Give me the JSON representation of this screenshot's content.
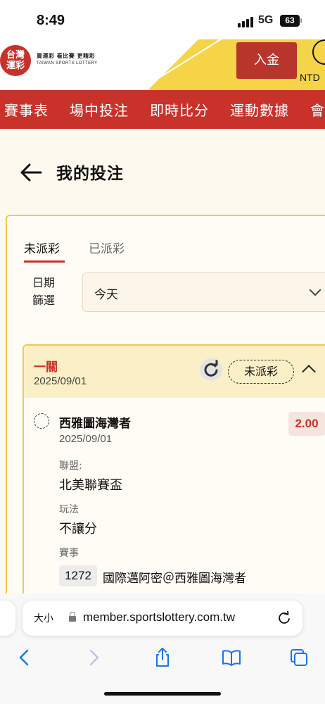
{
  "status_bar": {
    "time": "8:49",
    "network": "5G",
    "battery": "63"
  },
  "header": {
    "logo_mark": "台灣\n運彩",
    "logo_tagline": "買運彩 看比賽 更精彩",
    "logo_english": "TAIWAN SPORTS LOTTERY",
    "deposit_label": "入金",
    "currency": "NTD"
  },
  "nav": {
    "items": [
      "賽事表",
      "場中投注",
      "即時比分",
      "運動數據",
      "會員專"
    ]
  },
  "page": {
    "title": "我的投注",
    "tabs": [
      {
        "label": "未派彩",
        "active": true
      },
      {
        "label": "已派彩",
        "active": false
      }
    ],
    "filter": {
      "label": "日期\n篩選",
      "value": "今天"
    }
  },
  "bet": {
    "type": "一關",
    "date": "2025/09/01",
    "status": "未派彩",
    "selection": {
      "team": "西雅圖海灣者",
      "odds": "2.00",
      "date": "2025/09/01",
      "league_label": "聯盟:",
      "league": "北美聯賽盃",
      "market_label": "玩法",
      "market": "不讓分",
      "event_label": "賽事",
      "event_id": "1272",
      "event_name": "國際邁阿密＠西雅圖海灣者"
    }
  },
  "browser": {
    "text_size_label": "大小",
    "url": "member.sportslottery.com.tw"
  },
  "colors": {
    "brand_red": "#c9322a",
    "accent_yellow": "#f5d547",
    "page_bg": "#fdf9ef"
  }
}
